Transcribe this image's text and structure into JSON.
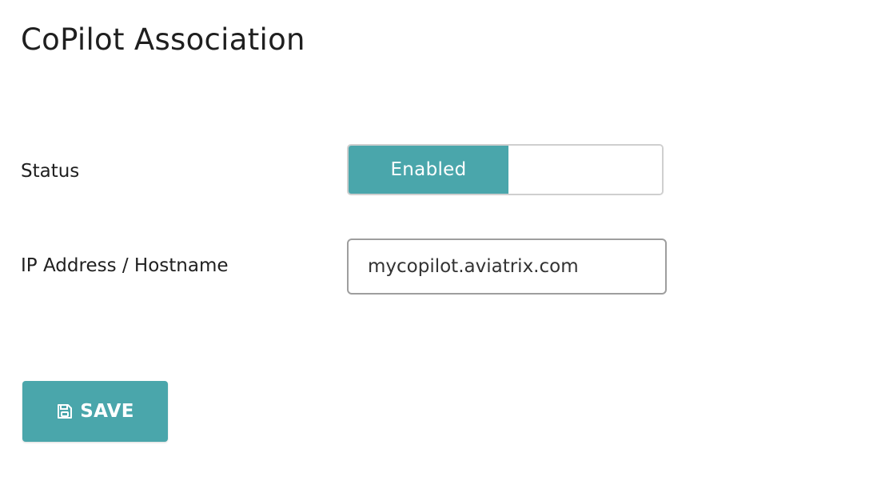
{
  "header": {
    "title": "CoPilot Association"
  },
  "form": {
    "status": {
      "label": "Status",
      "value_label": "Enabled",
      "enabled": true
    },
    "ip_hostname": {
      "label": "IP Address / Hostname",
      "value": "mycopilot.aviatrix.com"
    }
  },
  "actions": {
    "save_label": "SAVE",
    "save_icon": "save-icon"
  },
  "colors": {
    "accent": "#4aa6ab"
  }
}
